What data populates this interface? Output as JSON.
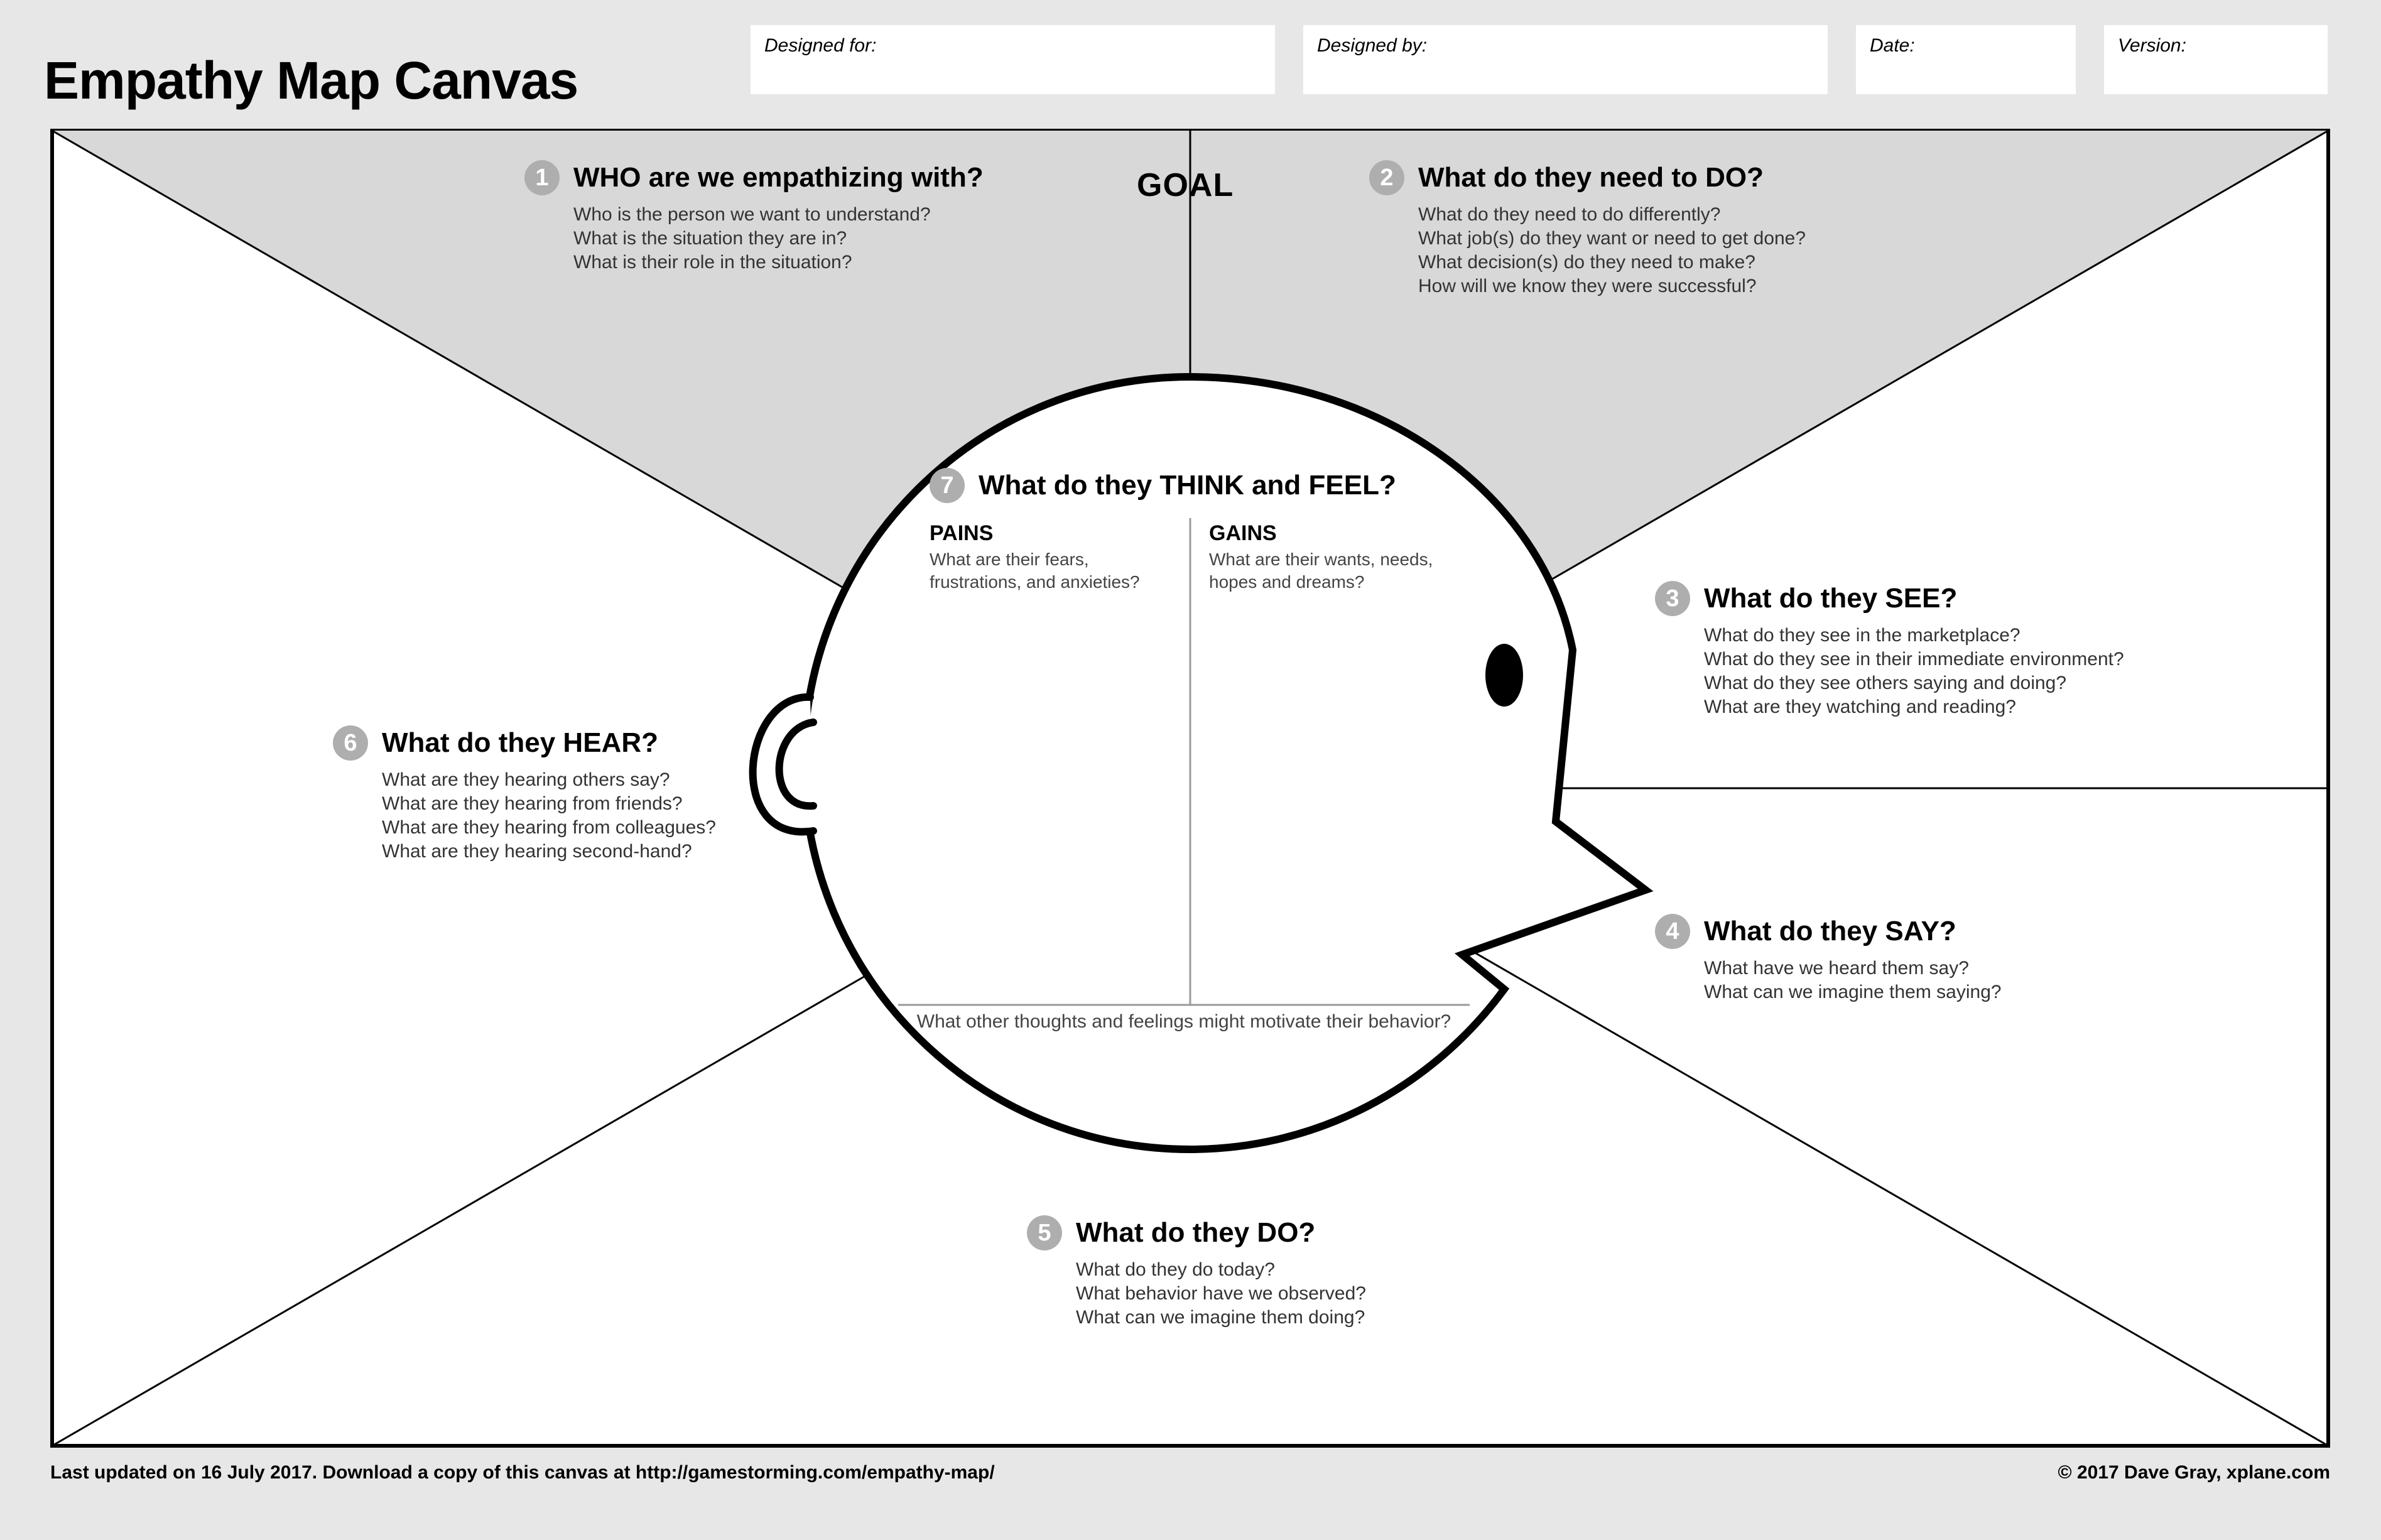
{
  "title": "Empathy Map Canvas",
  "meta": {
    "designed_for": "Designed for:",
    "designed_by": "Designed by:",
    "date": "Date:",
    "version": "Version:"
  },
  "goal": "GOAL",
  "sections": {
    "s1": {
      "num": "1",
      "title": "WHO are we empathizing with?",
      "prompts": [
        "Who is the person we want to understand?",
        "What is the situation they are in?",
        "What is their role in the situation?"
      ]
    },
    "s2": {
      "num": "2",
      "title": "What do they need to DO?",
      "prompts": [
        "What do they need to do differently?",
        "What job(s) do they want or need to get done?",
        "What decision(s) do they need to make?",
        "How will we know they were successful?"
      ]
    },
    "s3": {
      "num": "3",
      "title": "What do they SEE?",
      "prompts": [
        "What do they see in the marketplace?",
        "What do they see in their immediate environment?",
        "What do they see others saying and doing?",
        "What are they watching and reading?"
      ]
    },
    "s4": {
      "num": "4",
      "title": "What do they SAY?",
      "prompts": [
        "What have we heard them say?",
        "What can we imagine them saying?"
      ]
    },
    "s5": {
      "num": "5",
      "title": "What do they DO?",
      "prompts": [
        "What do they do today?",
        "What behavior have we observed?",
        "What can we imagine them doing?"
      ]
    },
    "s6": {
      "num": "6",
      "title": "What do they HEAR?",
      "prompts": [
        "What are they hearing others say?",
        "What are they hearing from friends?",
        "What are they hearing from colleagues?",
        "What are they hearing second-hand?"
      ]
    },
    "s7": {
      "num": "7",
      "title": "What do they THINK and FEEL?",
      "pains_label": "PAINS",
      "pains_body": "What are their fears, frustrations, and anxieties?",
      "gains_label": "GAINS",
      "gains_body": "What are their wants, needs, hopes and dreams?",
      "footer": "What other thoughts and feelings might motivate their behavior?"
    }
  },
  "footer": {
    "left": "Last updated on 16 July 2017. Download a copy of this canvas at http://gamestorming.com/empathy-map/",
    "right": "© 2017 Dave Gray, xplane.com"
  }
}
